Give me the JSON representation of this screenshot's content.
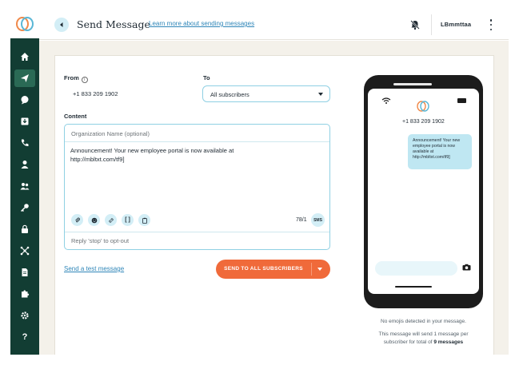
{
  "header": {
    "title": "Send Message",
    "learn_link": "Learn more about sending messages",
    "user": "LBmmttaa"
  },
  "sidebar": {
    "items": [
      {
        "icon": "home-icon"
      },
      {
        "icon": "send-icon",
        "active": true
      },
      {
        "icon": "chat-icon"
      },
      {
        "icon": "inbox-icon"
      },
      {
        "icon": "phone-icon"
      },
      {
        "icon": "user-icon"
      },
      {
        "icon": "users-icon"
      },
      {
        "icon": "key-icon"
      },
      {
        "icon": "lock-icon"
      },
      {
        "icon": "network-icon"
      },
      {
        "icon": "document-icon"
      },
      {
        "icon": "puzzle-icon"
      },
      {
        "icon": "gear-icon"
      },
      {
        "icon": "help-icon",
        "label": "?"
      }
    ]
  },
  "form": {
    "from_label": "From",
    "from_info": "i",
    "from_value": "+1 833 209 1902",
    "to_label": "To",
    "to_value": "All subscribers",
    "content_label": "Content",
    "org_placeholder": "Organization Name (optional)",
    "message_line1": "Announcement! Your new employee portal is now available at",
    "message_line2": "http://mbltxt.com/tf9]",
    "char_count": "78/1",
    "sms_badge": "SMS",
    "bracket_tool": "[ ]",
    "optout": "Reply 'stop' to opt-out",
    "test_link": "Send a test message",
    "send_button": "SEND TO ALL SUBSCRIBERS"
  },
  "preview": {
    "phone_number": "+1 833 209 1902",
    "bubble_text": "Announcement! Your new employee portal is now available at http://mbltxt.com/tf9]",
    "emoji_note": "No emojis detected in your message.",
    "send_note_1": "This message will send 1 message per",
    "send_note_2": "subscriber for total of",
    "send_note_bold": "9 messages"
  },
  "colors": {
    "sidebar": "#123d33",
    "accent_orange": "#f06a3a",
    "accent_blue": "#8fd0e3",
    "link": "#2f86b8"
  }
}
